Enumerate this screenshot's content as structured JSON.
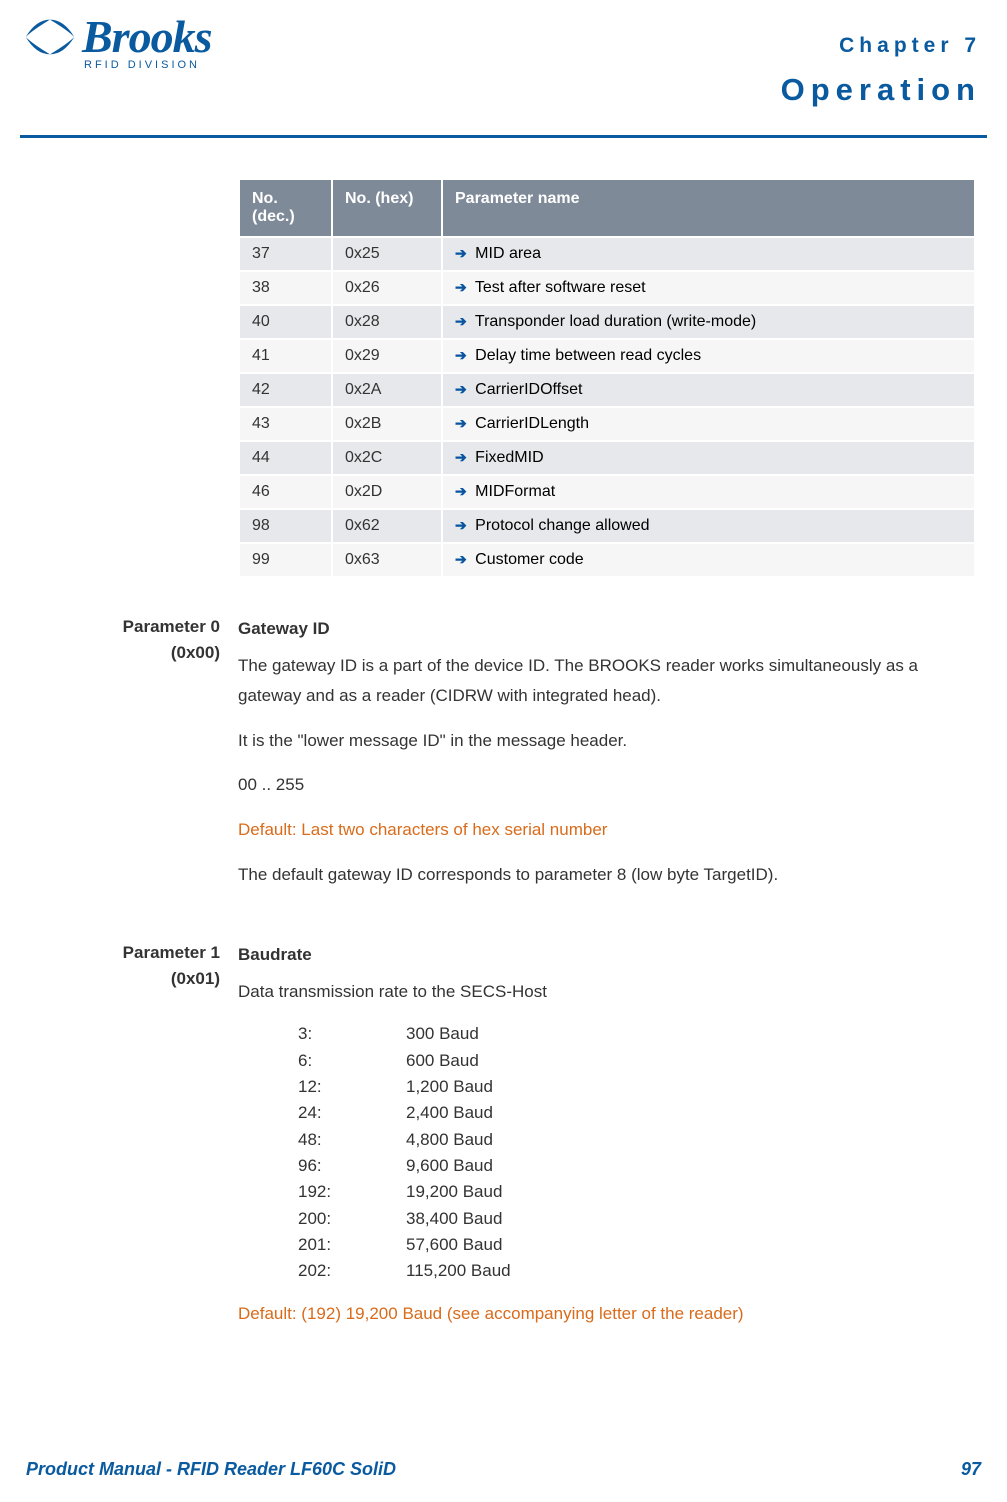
{
  "header": {
    "logo_text": "Brooks",
    "rfid": "RFID DIVISION",
    "chapter": "Chapter 7",
    "title": "Operation"
  },
  "table": {
    "headers": {
      "dec": "No. (dec.)",
      "hex": "No. (hex)",
      "name": "Parameter name"
    },
    "rows": [
      {
        "dec": "37",
        "hex": "0x25",
        "name": "MID area"
      },
      {
        "dec": "38",
        "hex": "0x26",
        "name": "Test after software reset"
      },
      {
        "dec": "40",
        "hex": "0x28",
        "name": "Transponder load duration (write-mode)"
      },
      {
        "dec": "41",
        "hex": "0x29",
        "name": "Delay time between read cycles"
      },
      {
        "dec": "42",
        "hex": "0x2A",
        "name": "CarrierIDOffset"
      },
      {
        "dec": "43",
        "hex": "0x2B",
        "name": "CarrierIDLength"
      },
      {
        "dec": "44",
        "hex": "0x2C",
        "name": "FixedMID"
      },
      {
        "dec": "46",
        "hex": "0x2D",
        "name": "MIDFormat"
      },
      {
        "dec": "98",
        "hex": "0x62",
        "name": "Protocol change allowed"
      },
      {
        "dec": "99",
        "hex": "0x63",
        "name": "Customer code"
      }
    ]
  },
  "param0": {
    "side1": "Parameter 0",
    "side2": "(0x00)",
    "h": "Gateway ID",
    "p1": "The gateway ID is a part of the device ID. The BROOKS reader works simultaneously as a gateway and as a reader (CIDRW with integrated head).",
    "p2": "It is the \"lower message ID\" in the message header.",
    "p3": "00 .. 255",
    "default": "Default: Last two characters of hex serial number",
    "p4": "The default gateway ID corresponds to parameter 8 (low byte TargetID)."
  },
  "param1": {
    "side1": "Parameter 1",
    "side2": "(0x01)",
    "h": "Baudrate",
    "p1": "Data transmission rate to the SECS-Host",
    "rates": [
      {
        "k": "3:",
        "v": "300 Baud"
      },
      {
        "k": "6:",
        "v": "600 Baud"
      },
      {
        "k": "12:",
        "v": "1,200 Baud"
      },
      {
        "k": "24:",
        "v": "2,400 Baud"
      },
      {
        "k": "48:",
        "v": "4,800 Baud"
      },
      {
        "k": "96:",
        "v": "9,600 Baud"
      },
      {
        "k": "192:",
        "v": "19,200 Baud"
      },
      {
        "k": "200:",
        "v": "38,400 Baud"
      },
      {
        "k": "201:",
        "v": "57,600 Baud"
      },
      {
        "k": "202:",
        "v": "115,200 Baud"
      }
    ],
    "default": "Default: (192) 19,200 Baud (see accompanying letter of the reader)"
  },
  "footer": {
    "left": "Product Manual - RFID Reader LF60C SoliD",
    "right": "97"
  }
}
